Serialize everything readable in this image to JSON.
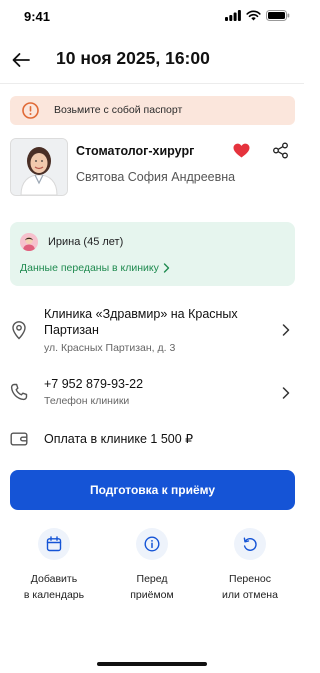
{
  "status_bar": {
    "time": "9:41"
  },
  "header": {
    "title": "10 ноя 2025, 16:00"
  },
  "alert": {
    "text": "Возьмите с собой паспорт"
  },
  "doctor": {
    "specialty": "Стоматолог-хирург",
    "name": "Святова София Андреевна"
  },
  "patient": {
    "name": "Ирина (45 лет)",
    "link": "Данные переданы в клинику"
  },
  "clinic": {
    "title_line1": "Клиника «Здравмир» на Красных",
    "title_line2": "Партизан",
    "address": "ул. Красных Партизан, д. 3"
  },
  "phone": {
    "number": "+7 952 879-93-22",
    "label": "Телефон клиники"
  },
  "payment": {
    "text": "Оплата в клинике 1 500 ₽"
  },
  "primary_button": {
    "label": "Подготовка к приёму"
  },
  "actions": [
    {
      "line1": "Добавить",
      "line2": "в календарь"
    },
    {
      "line1": "Перед",
      "line2": "приёмом"
    },
    {
      "line1": "Перенос",
      "line2": "или отмена"
    }
  ],
  "colors": {
    "accent": "#1554d6",
    "alert_bg": "#fbe6dc",
    "alert_icon": "#e06a36",
    "patient_bg": "#e6f5ee",
    "success": "#1f8a4f",
    "heart": "#e5333d"
  }
}
